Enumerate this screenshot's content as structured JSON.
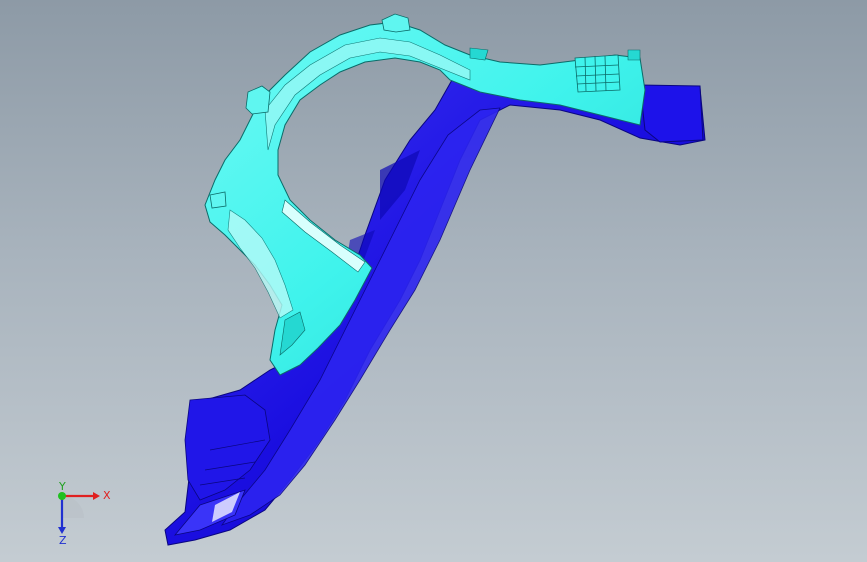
{
  "triad": {
    "x_label": "X",
    "y_label": "Y",
    "z_label": "Z"
  },
  "colors": {
    "upper_part": "#3ff5ef",
    "lower_part": "#1c10e8",
    "axis_x": "#e02020",
    "axis_y": "#20c020",
    "axis_z": "#2030d0"
  }
}
